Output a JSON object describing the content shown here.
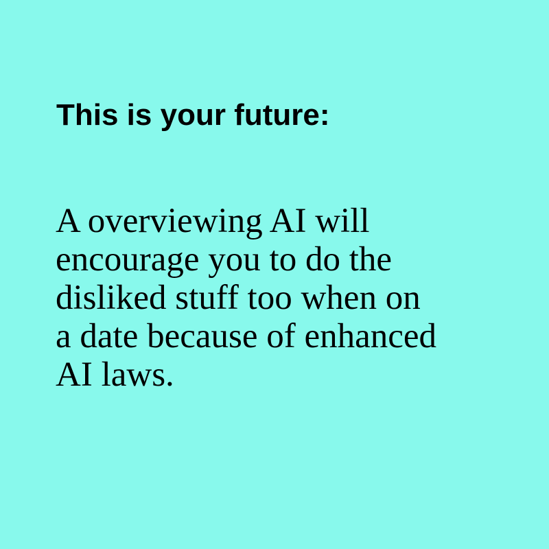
{
  "colors": {
    "background": "#88f9ec",
    "text": "#000000"
  },
  "heading": "This is your future:",
  "body_lines": [
    "A overviewing AI will",
    "encourage you to do the",
    "disliked stuff too when on",
    "a date because of enhanced",
    "AI laws."
  ]
}
